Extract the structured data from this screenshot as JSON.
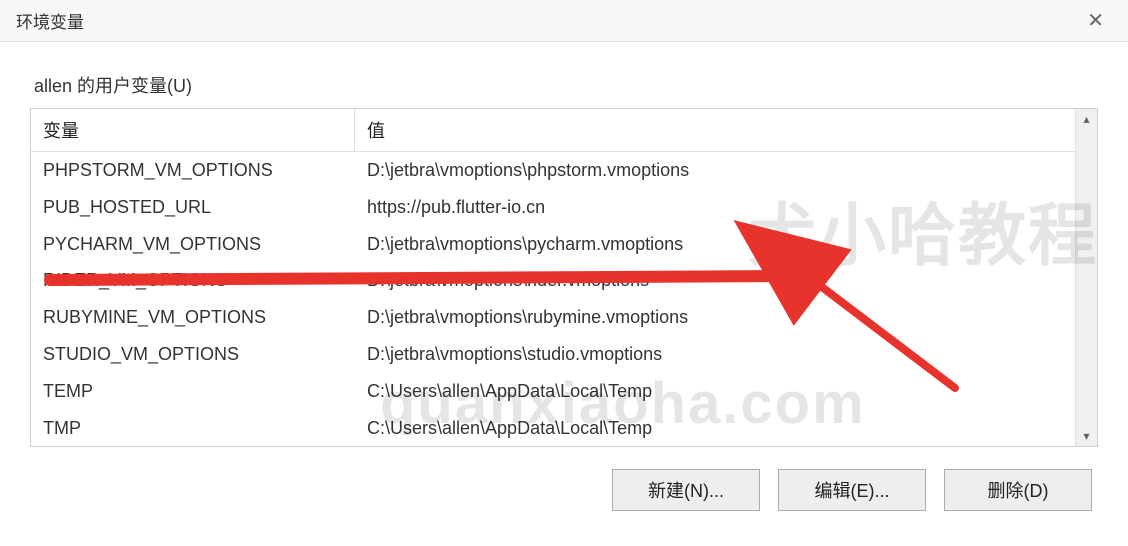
{
  "title": "环境变量",
  "group_label": "allen 的用户变量(U)",
  "columns": {
    "variable": "变量",
    "value": "值"
  },
  "rows": [
    {
      "variable": "PHPSTORM_VM_OPTIONS",
      "value": "D:\\jetbra\\vmoptions\\phpstorm.vmoptions"
    },
    {
      "variable": "PUB_HOSTED_URL",
      "value": "https://pub.flutter-io.cn"
    },
    {
      "variable": "PYCHARM_VM_OPTIONS",
      "value": "D:\\jetbra\\vmoptions\\pycharm.vmoptions"
    },
    {
      "variable": "RIDER_VM_OPTIONS",
      "value": "D:\\jetbra\\vmoptions\\rider.vmoptions"
    },
    {
      "variable": "RUBYMINE_VM_OPTIONS",
      "value": "D:\\jetbra\\vmoptions\\rubymine.vmoptions"
    },
    {
      "variable": "STUDIO_VM_OPTIONS",
      "value": "D:\\jetbra\\vmoptions\\studio.vmoptions"
    },
    {
      "variable": "TEMP",
      "value": "C:\\Users\\allen\\AppData\\Local\\Temp"
    },
    {
      "variable": "TMP",
      "value": "C:\\Users\\allen\\AppData\\Local\\Temp"
    }
  ],
  "buttons": {
    "new": "新建(N)...",
    "edit": "编辑(E)...",
    "delete": "删除(D)"
  },
  "watermarks": {
    "w1": "犬小哈教程",
    "w2": "quanxiaoha.com"
  },
  "annotation_color": "#e8332d"
}
